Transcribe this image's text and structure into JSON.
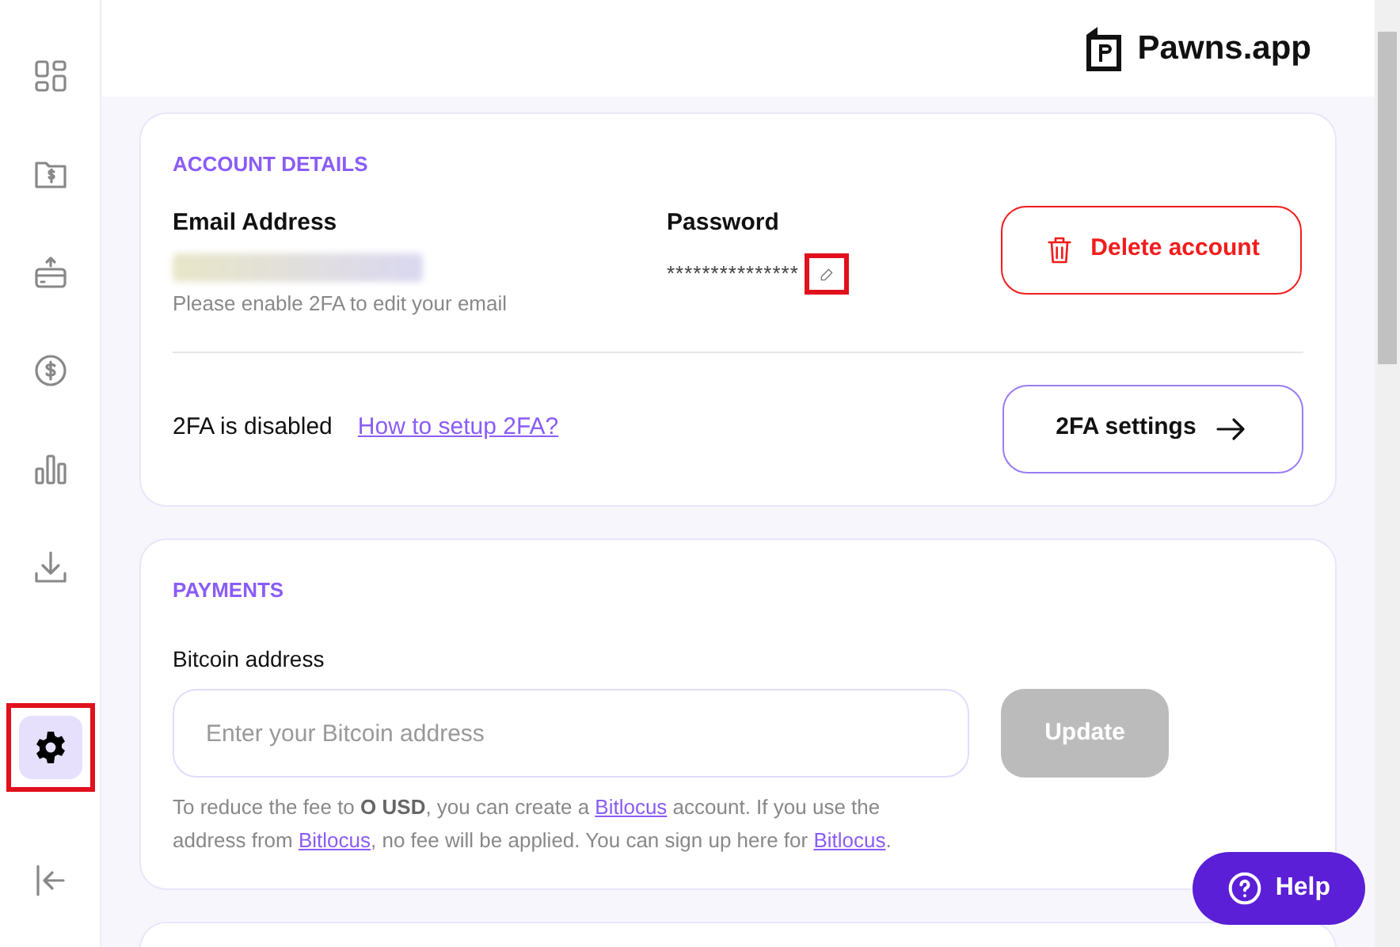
{
  "brand": {
    "name": "Pawns.app"
  },
  "sidebar": {
    "items": [
      {
        "kind": "dashboard",
        "selected": false,
        "highlighted": false
      },
      {
        "kind": "wallet",
        "selected": false,
        "highlighted": false
      },
      {
        "kind": "card",
        "selected": false,
        "highlighted": false
      },
      {
        "kind": "dollar",
        "selected": false,
        "highlighted": false
      },
      {
        "kind": "chart",
        "selected": false,
        "highlighted": false
      },
      {
        "kind": "download",
        "selected": false,
        "highlighted": false
      }
    ],
    "bottom_items": [
      {
        "kind": "settings",
        "selected": true,
        "highlighted": true
      },
      {
        "kind": "logout",
        "selected": false,
        "highlighted": false
      }
    ]
  },
  "account": {
    "heading": "ACCOUNT DETAILS",
    "email_label": "Email Address",
    "email_hint": "Please enable 2FA to edit your email",
    "password_label": "Password",
    "password_value": "***************",
    "edit_highlighted": true,
    "delete_button": "Delete account",
    "twofa_status": "2FA is disabled",
    "twofa_link": "How to setup 2FA?",
    "twofa_button": "2FA settings"
  },
  "payments": {
    "heading": "PAYMENTS",
    "label": "Bitcoin address",
    "placeholder": "Enter your Bitcoin address",
    "button": "Update",
    "button_disabled": true,
    "note": [
      {
        "kind": "text",
        "text": "To reduce the fee to **O USD**, you can create a "
      },
      {
        "kind": "link",
        "text": "Bitlocus"
      },
      {
        "kind": "text",
        "text": " account. If you use the address from "
      },
      {
        "kind": "link",
        "text": "Bitlocus"
      },
      {
        "kind": "text",
        "text": ", no fee will be applied. You can sign up here for "
      },
      {
        "kind": "link",
        "text": "Bitlocus"
      },
      {
        "kind": "text",
        "text": "."
      }
    ]
  },
  "help_button": "Help"
}
